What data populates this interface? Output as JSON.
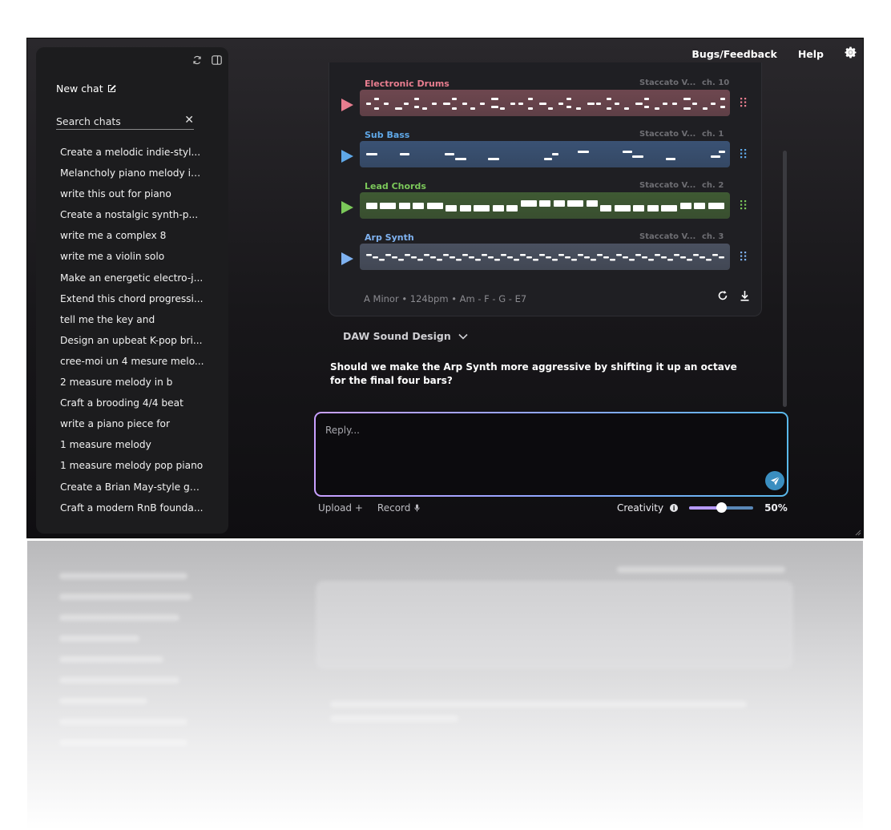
{
  "sidebar": {
    "new_chat_label": "New chat",
    "search_placeholder": "Search chats",
    "chats": [
      "Create a melodic indie-styl...",
      "Melancholy piano melody in...",
      "write this out for piano",
      "Create a nostalgic synth-p...",
      "write me a complex 8",
      "write me a violin solo",
      "Make an energetic electro-j...",
      "Extend this chord progressi...",
      "tell me the key and",
      "Design an upbeat K-pop bri...",
      "cree-moi un 4 mesure melo...",
      "2 measure melody in b",
      "Craft a brooding 4/4 beat",
      "write a piano piece for",
      "1 measure melody",
      "1 measure melody pop piano",
      "Create a Brian May-style gu...",
      "Craft a modern RnB founda..."
    ]
  },
  "topnav": {
    "bugs_label": "Bugs/Feedback",
    "help_label": "Help"
  },
  "tracks": [
    {
      "name": "Electronic Drums",
      "instrument": "Staccato V...",
      "channel": "ch. 10",
      "color": "#e87d8f",
      "lane_color": "#6e474f"
    },
    {
      "name": "Sub Bass",
      "instrument": "Staccato V...",
      "channel": "ch. 1",
      "color": "#5fa8e8",
      "lane_color": "#3a5274"
    },
    {
      "name": "Lead Chords",
      "instrument": "Staccato V...",
      "channel": "ch. 2",
      "color": "#7bc85a",
      "lane_color": "#3f5a33"
    },
    {
      "name": "Arp Synth",
      "instrument": "Staccato V...",
      "channel": "ch. 3",
      "color": "#7fb2f0",
      "lane_color": "#4a5160"
    }
  ],
  "summary": "A Minor • 124bpm • Am - F - G - E7",
  "daw_label": "DAW Sound Design",
  "question": "Should we make the Arp Synth more aggressive by shifting it up an octave for the final four bars?",
  "reply_placeholder": "Reply...",
  "upload_label": "Upload +",
  "record_label": "Record",
  "creativity": {
    "label": "Creativity",
    "value": 0.5,
    "display": "50%"
  }
}
